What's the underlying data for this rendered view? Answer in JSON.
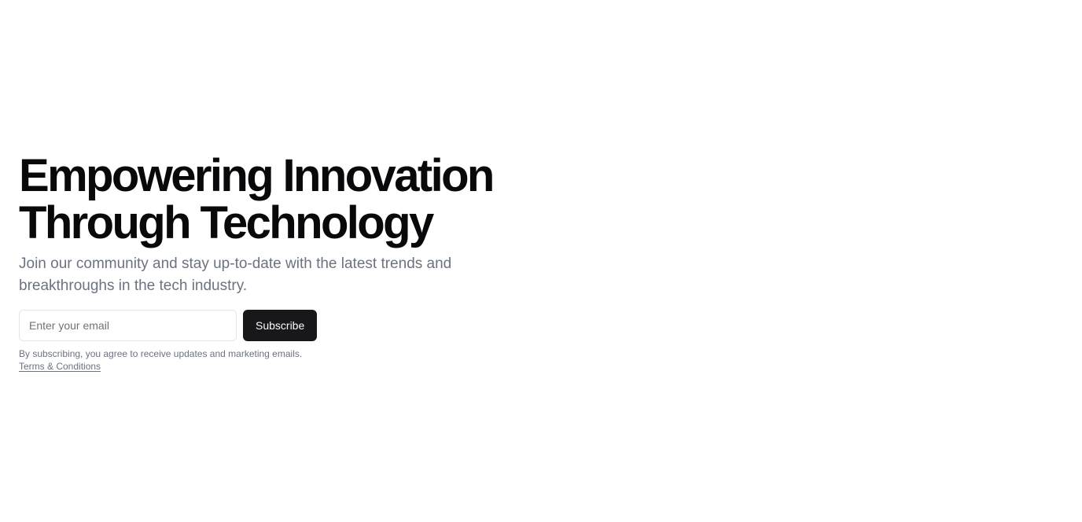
{
  "hero": {
    "title_line1": "Empowering Innovation",
    "title_line2": "Through Technology",
    "subtitle": "Join our community and stay up-to-date with the latest trends and breakthroughs in the tech industry."
  },
  "signup": {
    "email_placeholder": "Enter your email",
    "email_value": "",
    "subscribe_label": "Subscribe"
  },
  "fineprint": {
    "consent_text": "By subscribing, you agree to receive updates and marketing emails.",
    "terms_link": "Terms & Conditions"
  },
  "colors": {
    "title": "#09090b",
    "muted_text": "#6b7280",
    "button_bg": "#18181b",
    "button_text": "#fafafa",
    "input_border": "#e4e4e7"
  }
}
